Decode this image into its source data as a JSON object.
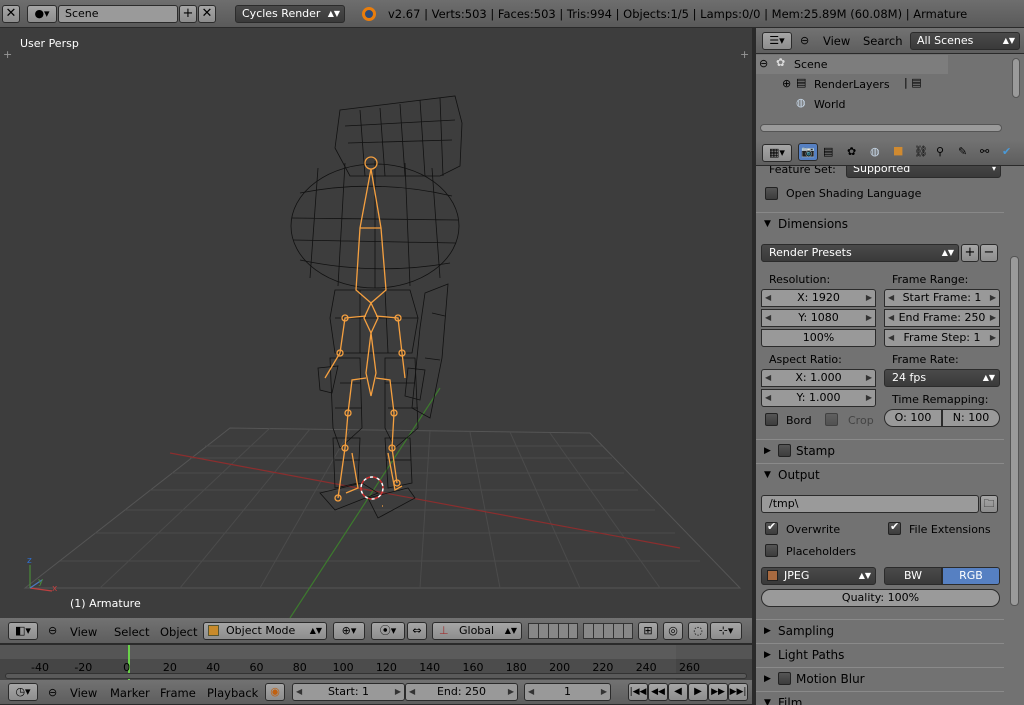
{
  "top_header": {
    "scene_name": "Scene",
    "render_engine": "Cycles Render",
    "stats": "v2.67 | Verts:503 | Faces:503 | Tris:994 | Objects:1/5 | Lamps:0/0 | Mem:25.89M (60.08M) | Armature"
  },
  "viewport": {
    "view_name": "User Persp",
    "object_label": "(1) Armature",
    "header": {
      "menus": [
        "View",
        "Select",
        "Object"
      ],
      "mode": "Object Mode",
      "orientation": "Global"
    },
    "colors": {
      "bg": "#3d3d3d",
      "grid": "#4a4a4a",
      "armature": "#f5a040",
      "x_axis": "#8b2e2e",
      "y_axis": "#3d7a2e"
    }
  },
  "outliner": {
    "menus": [
      "View",
      "Search"
    ],
    "scope": "All Scenes",
    "items": [
      "Scene",
      "RenderLayers",
      "World"
    ]
  },
  "properties": {
    "feature_set_label": "Feature Set:",
    "feature_set_value": "Supported",
    "open_shading_language": "Open Shading Language",
    "dimensions": {
      "title": "Dimensions",
      "presets": "Render Presets",
      "resolution_label": "Resolution:",
      "res_x": "X: 1920",
      "res_y": "Y: 1080",
      "res_pct": "100%",
      "frame_range_label": "Frame Range:",
      "start_frame": "Start Frame: 1",
      "end_frame": "End Frame: 250",
      "frame_step": "Frame Step: 1",
      "aspect_label": "Aspect Ratio:",
      "aspect_x": "X: 1.000",
      "aspect_y": "Y: 1.000",
      "frame_rate_label": "Frame Rate:",
      "frame_rate": "24 fps",
      "time_remap_label": "Time Remapping:",
      "remap_old": "O: 100",
      "remap_new": "N: 100",
      "bord": "Bord",
      "crop": "Crop"
    },
    "stamp": "Stamp",
    "output": {
      "title": "Output",
      "path": "/tmp\\",
      "overwrite": "Overwrite",
      "file_extensions": "File Extensions",
      "placeholders": "Placeholders",
      "format": "JPEG",
      "bw": "BW",
      "rgb": "RGB",
      "quality": "Quality: 100%"
    },
    "sampling": "Sampling",
    "light_paths": "Light Paths",
    "motion_blur": "Motion Blur",
    "film": "Film"
  },
  "timeline": {
    "ticks": [
      "-40",
      "-20",
      "0",
      "20",
      "40",
      "60",
      "80",
      "100",
      "120",
      "140",
      "160",
      "180",
      "200",
      "220",
      "240",
      "260"
    ],
    "menus": [
      "View",
      "Marker",
      "Frame",
      "Playback"
    ],
    "start": "Start: 1",
    "end": "End: 250",
    "current": "1"
  }
}
